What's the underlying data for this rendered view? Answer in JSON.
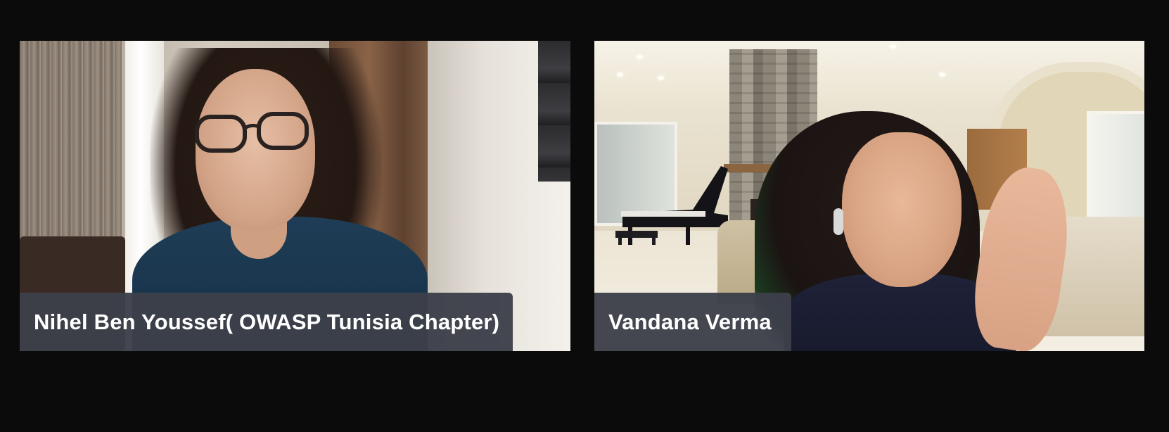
{
  "participants": [
    {
      "name": "Nihel Ben Youssef( OWASP Tunisia Chapter)"
    },
    {
      "name": "Vandana Verma"
    }
  ]
}
